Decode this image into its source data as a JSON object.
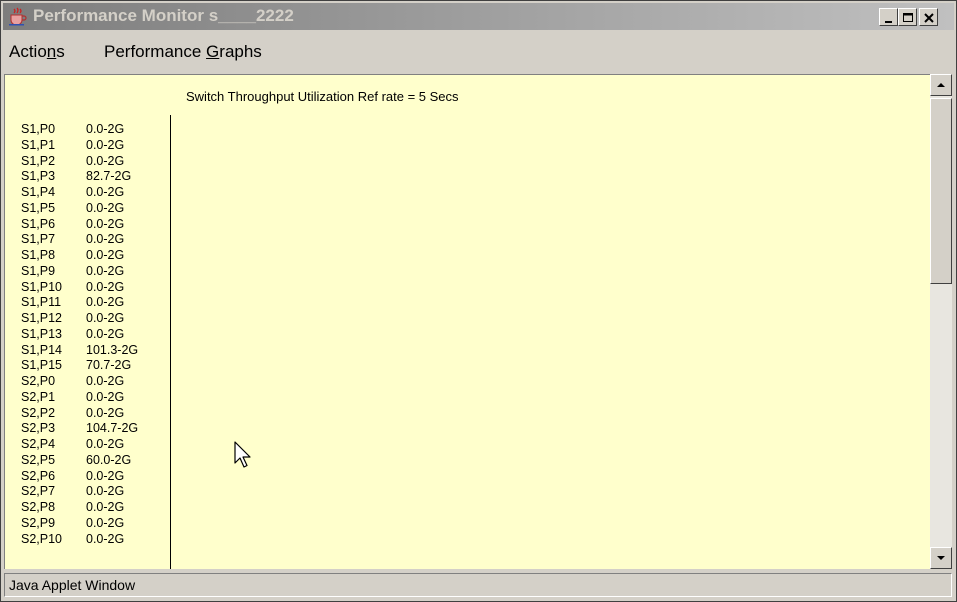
{
  "window": {
    "title": "Performance Monitor s____2222",
    "icon": "java-coffee-cup-icon",
    "controls": {
      "minimize": "minimize-icon",
      "maximize": "maximize-icon",
      "close": "close-icon"
    }
  },
  "menubar": {
    "actions": {
      "before": "Actio",
      "mnemonic": "n",
      "after": "s"
    },
    "graphs": {
      "before": "Performance ",
      "mnemonic": "G",
      "after": "raphs"
    }
  },
  "chart": {
    "title": "Switch Throughput Utilization Ref rate = 5 Secs"
  },
  "ports": [
    {
      "name": "S1,P0",
      "value": "0.0-2G"
    },
    {
      "name": "S1,P1",
      "value": "0.0-2G"
    },
    {
      "name": "S1,P2",
      "value": "0.0-2G"
    },
    {
      "name": "S1,P3",
      "value": "82.7-2G"
    },
    {
      "name": "S1,P4",
      "value": "0.0-2G"
    },
    {
      "name": "S1,P5",
      "value": "0.0-2G"
    },
    {
      "name": "S1,P6",
      "value": "0.0-2G"
    },
    {
      "name": "S1,P7",
      "value": "0.0-2G"
    },
    {
      "name": "S1,P8",
      "value": "0.0-2G"
    },
    {
      "name": "S1,P9",
      "value": "0.0-2G"
    },
    {
      "name": "S1,P10",
      "value": "0.0-2G"
    },
    {
      "name": "S1,P11",
      "value": "0.0-2G"
    },
    {
      "name": "S1,P12",
      "value": "0.0-2G"
    },
    {
      "name": "S1,P13",
      "value": "0.0-2G"
    },
    {
      "name": "S1,P14",
      "value": "101.3-2G"
    },
    {
      "name": "S1,P15",
      "value": "70.7-2G"
    },
    {
      "name": "S2,P0",
      "value": "0.0-2G"
    },
    {
      "name": "S2,P1",
      "value": "0.0-2G"
    },
    {
      "name": "S2,P2",
      "value": "0.0-2G"
    },
    {
      "name": "S2,P3",
      "value": "104.7-2G"
    },
    {
      "name": "S2,P4",
      "value": "0.0-2G"
    },
    {
      "name": "S2,P5",
      "value": "60.0-2G"
    },
    {
      "name": "S2,P6",
      "value": "0.0-2G"
    },
    {
      "name": "S2,P7",
      "value": "0.0-2G"
    },
    {
      "name": "S2,P8",
      "value": "0.0-2G"
    },
    {
      "name": "S2,P9",
      "value": "0.0-2G"
    },
    {
      "name": "S2,P10",
      "value": "0.0-2G"
    }
  ],
  "scrollbar": {
    "up": "scroll-up-arrow-icon",
    "down": "scroll-down-arrow-icon"
  },
  "status": {
    "text": "Java Applet Window"
  },
  "cursor": "mouse-pointer-icon"
}
